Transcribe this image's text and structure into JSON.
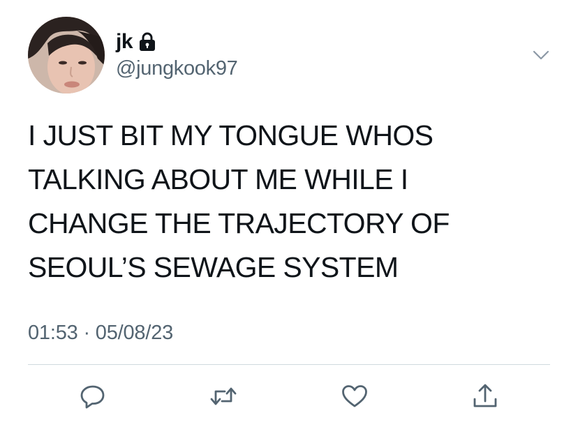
{
  "tweet": {
    "author": {
      "display_name": "jk",
      "handle": "@jungkook97",
      "verified_icon": "lock-icon",
      "avatar": "profile-photo"
    },
    "text": "I JUST BIT MY TONGUE WHOS\nTALKING ABOUT ME WHILE I\nCHANGE THE TRAJECTORY OF\nSEOUL’S SEWAGE SYSTEM",
    "time": "01:53",
    "separator": "·",
    "date": "05/08/23",
    "menu_icon": "chevron-down-icon"
  },
  "actions": [
    {
      "name": "reply",
      "icon": "reply-icon"
    },
    {
      "name": "retweet",
      "icon": "retweet-icon"
    },
    {
      "name": "like",
      "icon": "heart-icon"
    },
    {
      "name": "share",
      "icon": "share-icon"
    }
  ],
  "colors": {
    "text": "#0f1419",
    "secondary": "#536471",
    "divider": "#cfd9de",
    "icon": "#536471"
  }
}
